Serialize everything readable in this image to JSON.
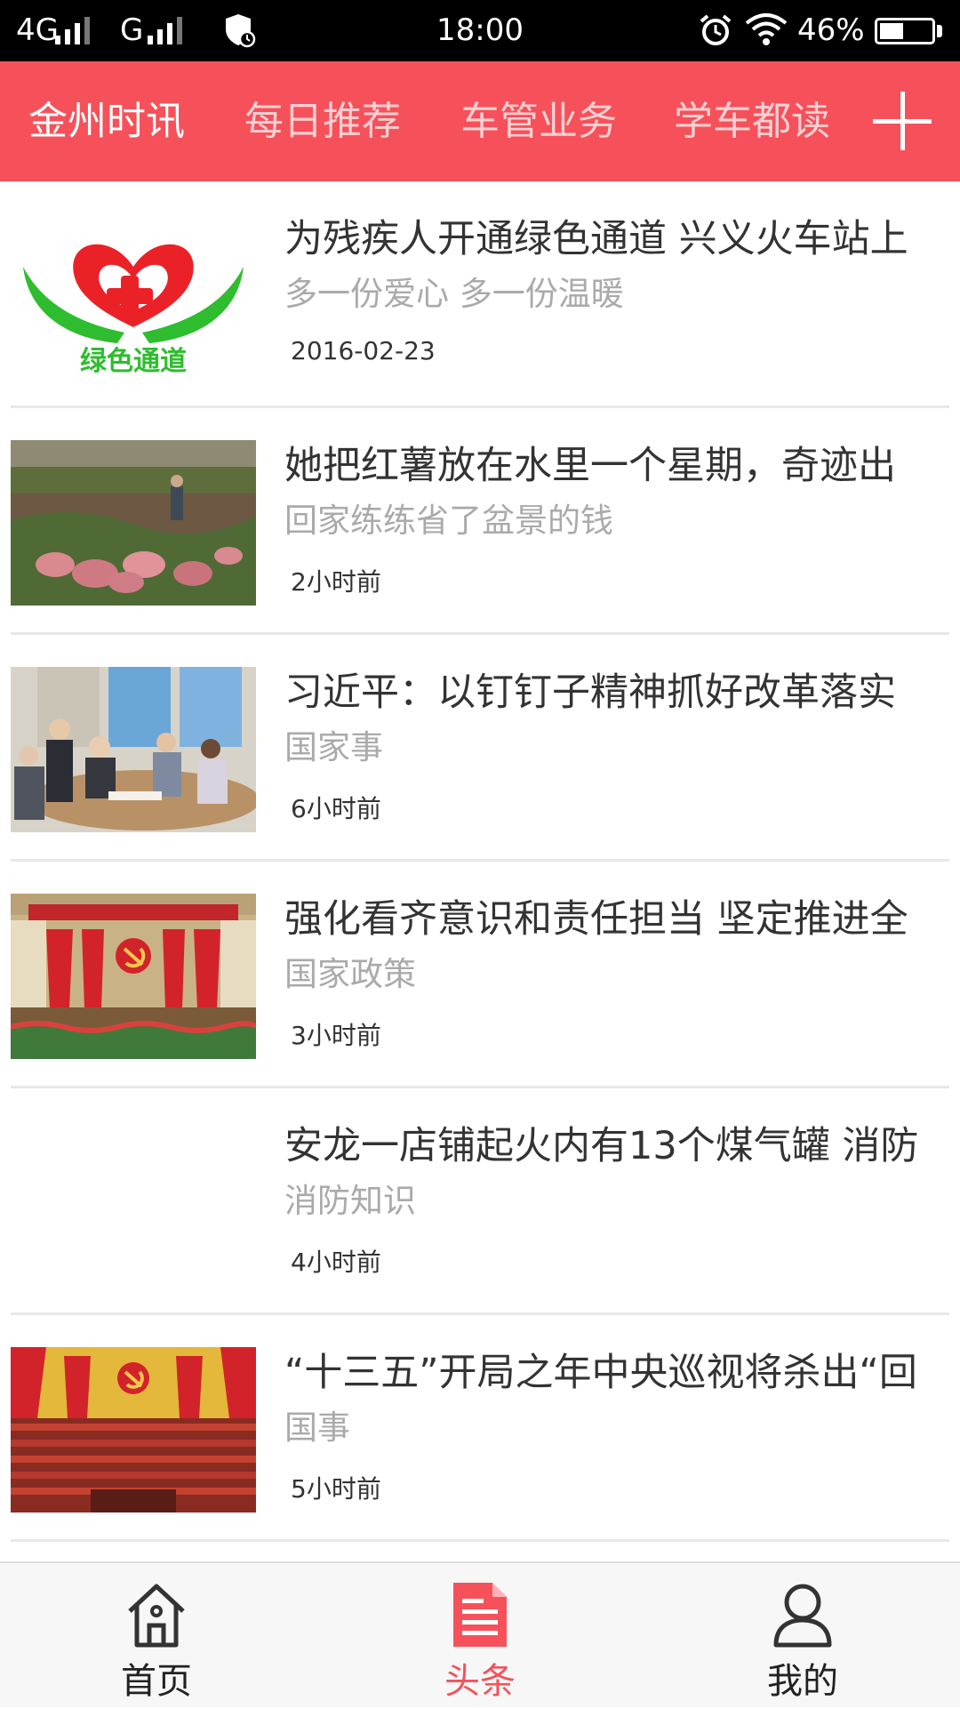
{
  "status_bar": {
    "network_1": "4G",
    "network_2": "G",
    "time": "18:00",
    "battery_text": "46%",
    "battery_level": 0.46
  },
  "top_tabs": [
    {
      "label": "金州时讯",
      "active": true
    },
    {
      "label": "每日推荐",
      "active": false
    },
    {
      "label": "车管业务",
      "active": false
    },
    {
      "label": "学车都读",
      "active": false
    }
  ],
  "add_tab_icon": "plus-icon",
  "news": [
    {
      "title": "为残疾人开通绿色通道 兴义火车站上",
      "subtitle": "多一份爱心 多一份温暖",
      "time": "2016-02-23",
      "thumb": "green-channel-logo",
      "thumb_text": "绿色通道"
    },
    {
      "title": "她把红薯放在水里一个星期，奇迹出",
      "subtitle": "回家练练省了盆景的钱",
      "time": "2小时前",
      "thumb": "sweet-potato-field-photo"
    },
    {
      "title": "习近平：以钉钉子精神抓好改革落实",
      "subtitle": "国家事",
      "time": "6小时前",
      "thumb": "business-meeting-photo"
    },
    {
      "title": "强化看齐意识和责任担当 坚定推进全",
      "subtitle": "国家政策",
      "time": "3小时前",
      "thumb": "party-congress-photo"
    },
    {
      "title": "安龙一店铺起火内有13个煤气罐 消防",
      "subtitle": "消防知识",
      "time": "4小时前",
      "thumb": ""
    },
    {
      "title": "“十三五”开局之年中央巡视将杀出“回",
      "subtitle": "国事",
      "time": "5小时前",
      "thumb": "party-congress-hall-photo"
    }
  ],
  "bottom_nav": [
    {
      "label": "首页",
      "icon": "home-icon",
      "active": false
    },
    {
      "label": "头条",
      "icon": "document-icon",
      "active": true
    },
    {
      "label": "我的",
      "icon": "user-icon",
      "active": false
    }
  ],
  "colors": {
    "accent": "#f6515a",
    "status_bar": "#000000",
    "subtitle_gray": "#aaaaaa"
  }
}
